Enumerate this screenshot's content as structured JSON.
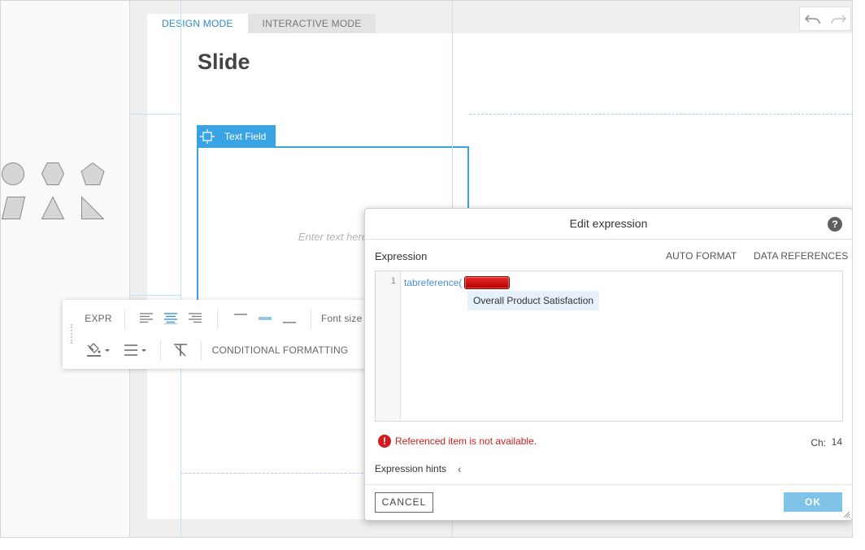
{
  "mode_tabs": [
    {
      "label": "DESIGN MODE",
      "active": true
    },
    {
      "label": "INTERACTIVE MODE",
      "active": false
    }
  ],
  "toolbar": {
    "undo_icon": "undo-icon",
    "redo_icon": "redo-icon"
  },
  "slide": {
    "title": "Slide",
    "text_field_tag": "Text Field",
    "text_field_placeholder": "Enter text here"
  },
  "shapes": [
    "circle",
    "hexagon",
    "pentagon",
    "parallelogram",
    "triangle",
    "right-triangle"
  ],
  "format_toolbar": {
    "expr_label": "EXPR",
    "font_size_label": "Font size",
    "conditional_formatting_label": "CONDITIONAL FORMATTING"
  },
  "dialog": {
    "title": "Edit expression",
    "help_label": "?",
    "expression_label": "Expression",
    "auto_format_label": "AUTO FORMAT",
    "data_references_label": "DATA REFERENCES",
    "editor": {
      "line_number": "1",
      "code": "tabreference(",
      "suggestion": "Overall Product Satisfaction"
    },
    "error_text": "Referenced item is not available.",
    "error_icon": "!",
    "ch_label": "Ch:",
    "ch_value": "14",
    "hints_label": "Expression hints",
    "hints_chevron": "‹",
    "cancel_label": "CANCEL",
    "ok_label": "OK"
  },
  "colors": {
    "accent": "#3aa3e3",
    "error": "#cc1f1f",
    "ok_button": "#7fc3e8",
    "token": "#d10000"
  }
}
